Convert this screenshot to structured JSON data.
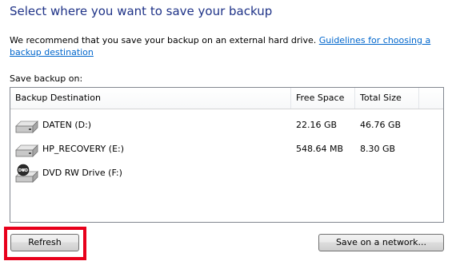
{
  "page": {
    "title": "Select where you want to save your backup",
    "intro_text": "We recommend that you save your backup on an external hard drive.",
    "guidelines_link": "Guidelines for choosing a backup destination",
    "save_label": "Save backup on:"
  },
  "table": {
    "columns": [
      "Backup Destination",
      "Free Space",
      "Total Size"
    ],
    "rows": [
      {
        "name": "DATEN (D:)",
        "free": "22.16 GB",
        "total": "46.76 GB",
        "icon": "hard-drive-icon"
      },
      {
        "name": "HP_RECOVERY (E:)",
        "free": "548.64 MB",
        "total": "8.30 GB",
        "icon": "hard-drive-icon"
      },
      {
        "name": "DVD RW Drive (F:)",
        "free": "",
        "total": "",
        "icon": "dvd-drive-icon"
      }
    ]
  },
  "buttons": {
    "refresh": "Refresh",
    "save_network": "Save on a network..."
  },
  "colors": {
    "title": "#1e3287",
    "link": "#0066cc",
    "highlight": "#e8001b"
  }
}
